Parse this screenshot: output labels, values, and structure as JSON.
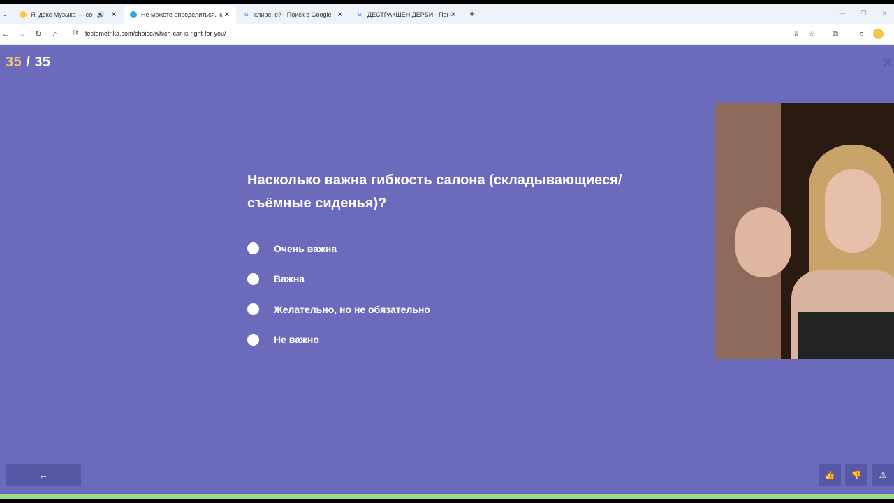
{
  "browser": {
    "tabs": [
      {
        "title": "Яндекс Музыка — собирае",
        "has_audio": true,
        "favicon": "yandex-music-icon",
        "favicon_color": "#f7c948",
        "active": false
      },
      {
        "title": "Не можете определиться, как",
        "has_audio": false,
        "favicon": "testometrika-icon",
        "favicon_color": "#3ba7e0",
        "active": true
      },
      {
        "title": "клиренс? - Поиск в Google",
        "has_audio": false,
        "favicon": "google-icon",
        "favicon_color": "#4285f4",
        "active": false
      },
      {
        "title": "ДЕСТРАКШЕН ДЕРБИ - Поиск",
        "has_audio": false,
        "favicon": "google-icon",
        "favicon_color": "#4285f4",
        "active": false
      }
    ],
    "url": "testometrika.com/choice/which-car-is-right-for-you/"
  },
  "quiz": {
    "current": "35",
    "separator": " / ",
    "total": "35",
    "question": "Насколько важна гибкость салона (складывающиеся/ съёмные сиденья)?",
    "options": [
      "Очень важна",
      "Важна",
      "Желательно, но не обязательно",
      "Не важно"
    ],
    "progress": 1.0
  },
  "colors": {
    "background": "#6b6abb",
    "accent_counter": "#f2c178",
    "progress": "#9bdc8e",
    "button": "#5857a6"
  }
}
